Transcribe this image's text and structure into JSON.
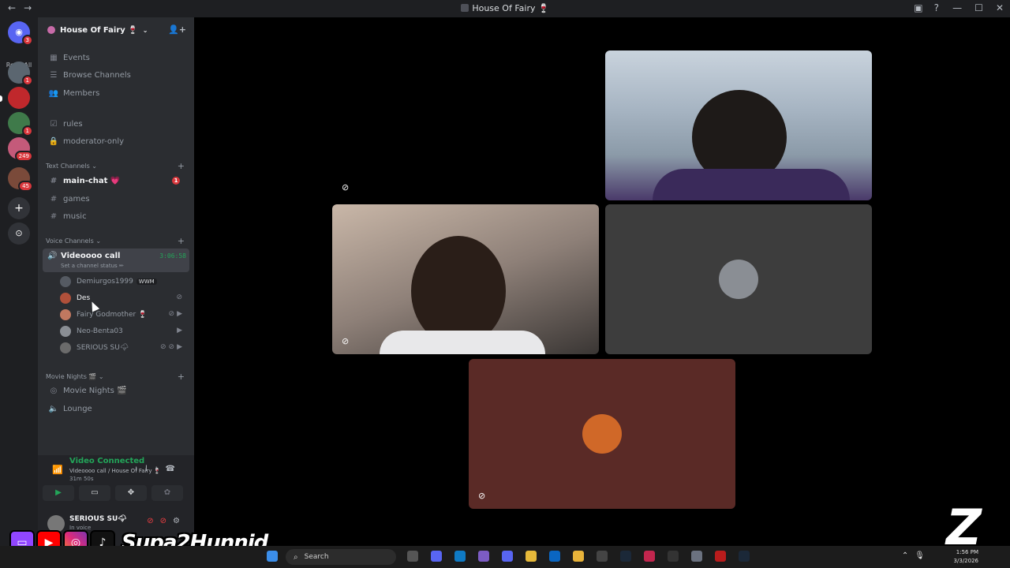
{
  "window": {
    "title": "House Of Fairy 🍷"
  },
  "servers": {
    "read_all_label": "Read All",
    "home_badge": "3",
    "items": [
      {
        "badge": "1",
        "color": "#5b6670"
      },
      {
        "badge": "",
        "color": "#c0282c"
      },
      {
        "badge": "1",
        "color": "#3f7a4a"
      },
      {
        "badge": "249",
        "color": "#c45a7a"
      },
      {
        "badge": "45",
        "color": "#7a4a3a"
      }
    ]
  },
  "guild": {
    "name": "House Of Fairy 🍷"
  },
  "nav": {
    "events": "Events",
    "browse": "Browse Channels",
    "members": "Members",
    "rules": "rules",
    "moderator": "moderator-only"
  },
  "text_channels": {
    "category": "Text Channels",
    "items": [
      {
        "name": "main-chat 💗",
        "badge": "1"
      },
      {
        "name": "games"
      },
      {
        "name": "music"
      }
    ]
  },
  "voice_channels": {
    "category": "Voice Channels",
    "active": {
      "name": "Videoooo call",
      "status": "Set a channel status ✏",
      "timer": "3:06:58"
    },
    "users": [
      {
        "name": "Demiurgos1999",
        "tag": "WWM",
        "color": "#555a62"
      },
      {
        "name": "Des",
        "color": "#b0503a"
      },
      {
        "name": "Fairy Godmother 🍷",
        "color": "#c07860"
      },
      {
        "name": "Neo-Benta03",
        "color": "#8a8e94"
      },
      {
        "name": "SERIOUS SU🌩",
        "color": "#6b6b6b"
      }
    ]
  },
  "movie_nights": {
    "category": "Movie Nights 🎬",
    "items": [
      {
        "name": "Movie Nights 🎬"
      },
      {
        "name": "Lounge"
      }
    ]
  },
  "voice_panel": {
    "connected": "Video Connected",
    "channel": "Videoooo call / House Of Fairy 🍷",
    "duration": "31m 50s"
  },
  "me": {
    "name": "SERIOUS SU🌩",
    "status": "In voice"
  },
  "social": {
    "handle": "Supa2Hunnid"
  },
  "taskbar": {
    "search_placeholder": "Search",
    "time": "1:56 PM",
    "date": "3/3/2026"
  },
  "colors": {
    "voice_green": "#23a559",
    "mention_red": "#da373c",
    "tile_grey": "#3d3d3d",
    "tile_maroon": "#5a2a26"
  }
}
